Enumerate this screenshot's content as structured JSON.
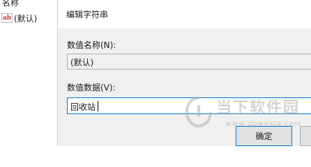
{
  "registry_pane": {
    "column_header": "名称",
    "row": {
      "icon": "string-value-icon",
      "icon_text": "ab",
      "label": "(默认)"
    }
  },
  "dialog": {
    "title": "编辑字符串",
    "value_name_label": "数值名称(N):",
    "value_name": "(默认)",
    "value_data_label": "数值数据(V):",
    "value_data": "回收站",
    "ok_label": "确定"
  },
  "watermark": {
    "text": "当下软件园",
    "url": "www.downxia.com"
  },
  "colors": {
    "focus_border": "#0078d7",
    "dialog_body": "#f0f0f0",
    "button_face": "#e1e1e1"
  }
}
